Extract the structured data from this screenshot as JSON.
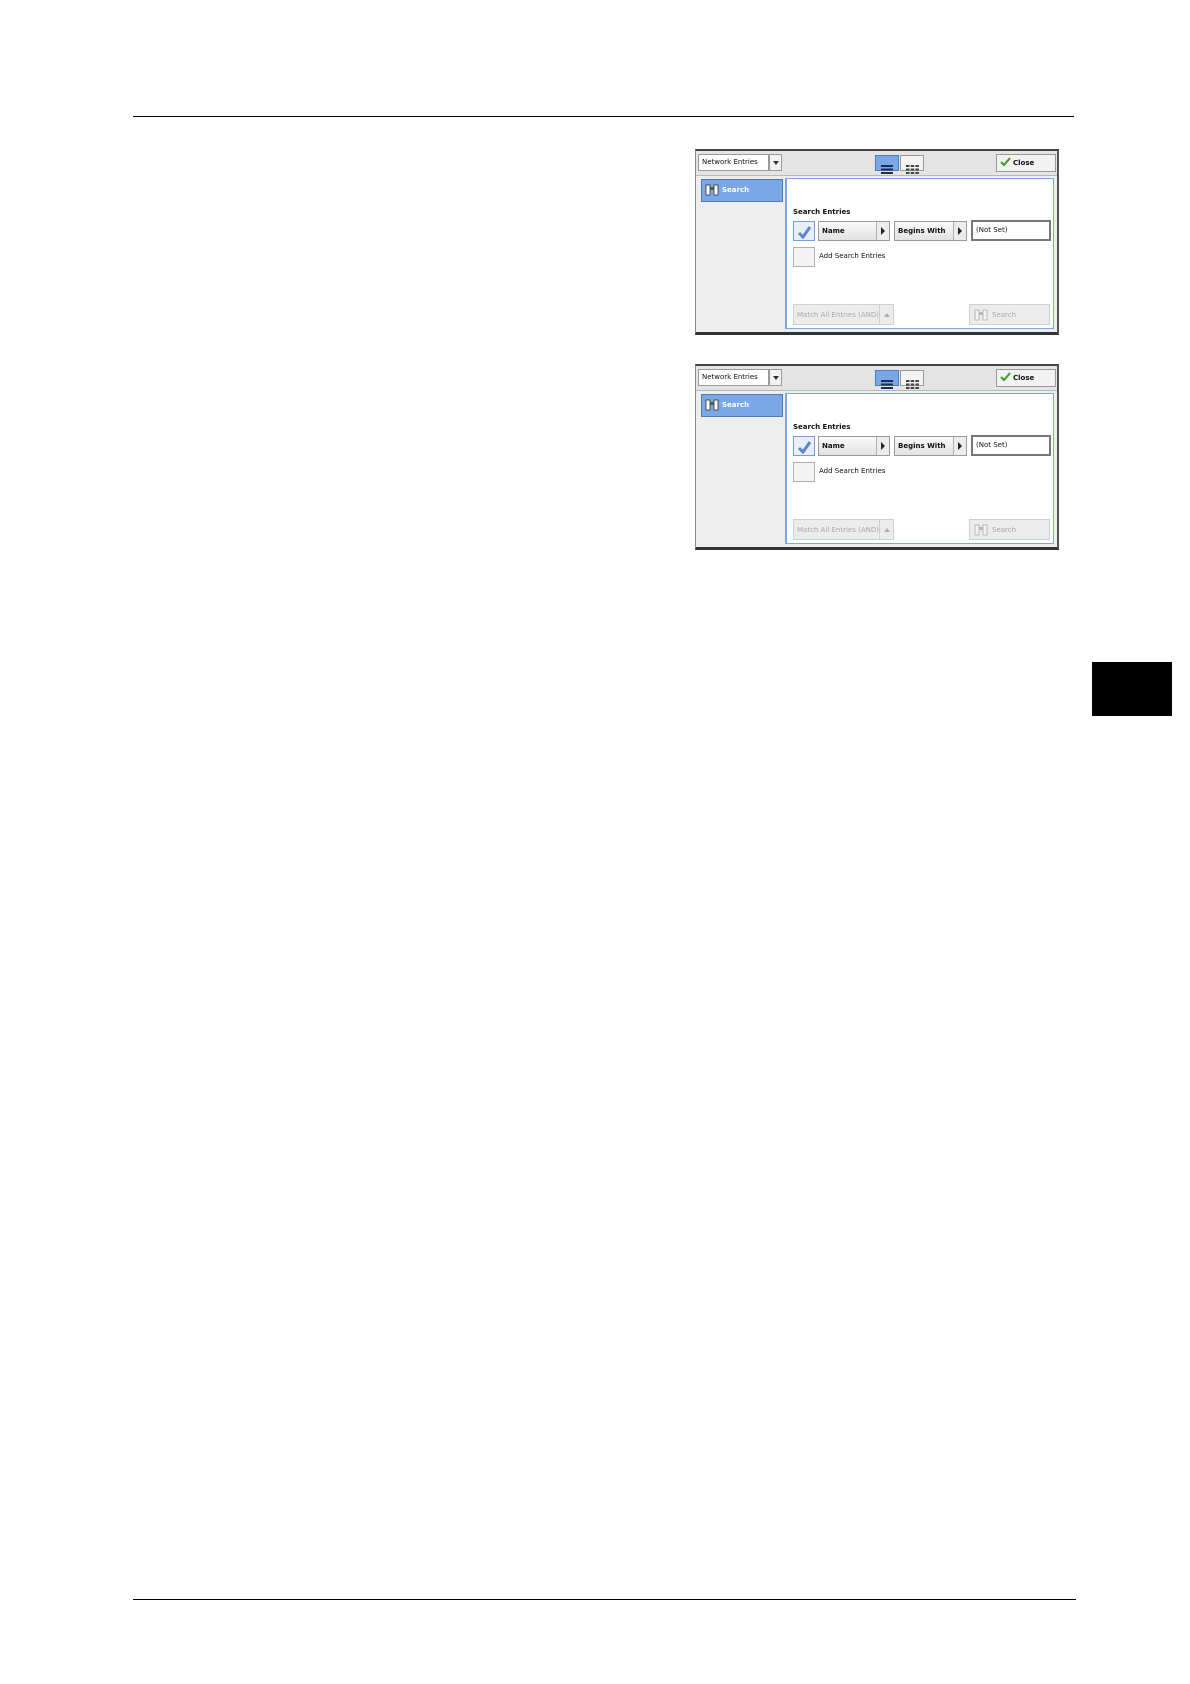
{
  "panels": [
    {
      "address_book_dropdown": "Network Entries",
      "close_label": "Close",
      "sidebar_search_label": "Search",
      "section_label": "Search Entries",
      "field_button": "Name",
      "condition_button": "Begins With",
      "value": "(Not Set)",
      "add_search_entries_label": "Add Search Entries",
      "match_dropdown": "Match All Entries (AND)",
      "search_button": "Search"
    },
    {
      "address_book_dropdown": "Network Entries",
      "close_label": "Close",
      "sidebar_search_label": "Search",
      "section_label": "Search Entries",
      "field_button": "Name",
      "condition_button": "Begins With",
      "value": "(Not Set)",
      "add_search_entries_label": "Add Search Entries",
      "match_dropdown": "Match All Entries (AND)",
      "search_button": "Search"
    }
  ],
  "colors": {
    "accent_blue": "#7aa7e6",
    "panel_bg": "#eeeeee",
    "side_tab_black": "#000000"
  }
}
